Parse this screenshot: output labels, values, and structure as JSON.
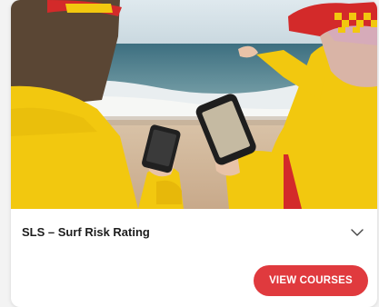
{
  "card": {
    "title": "SLS – Surf Risk Rating",
    "button_label": "VIEW COURSES"
  },
  "icons": {
    "expand": "chevron-down-icon"
  },
  "colors": {
    "accent": "#e03a3e",
    "lifeguard_yellow": "#f2c80f",
    "lifeguard_red": "#d32a2a"
  }
}
